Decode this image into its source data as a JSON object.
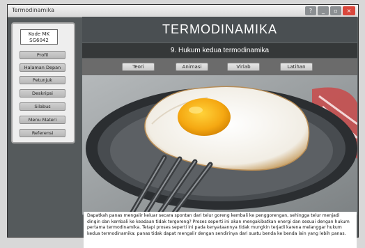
{
  "window": {
    "title": "Termodinamika"
  },
  "window_controls": [
    "?",
    "_",
    "▫",
    "×"
  ],
  "kode": {
    "line1": "Kode MK",
    "line2": "SG6042"
  },
  "sidebar": {
    "items": [
      {
        "label": "Profil"
      },
      {
        "label": "Halaman Depan"
      },
      {
        "label": "Petunjuk"
      },
      {
        "label": "Deskripsi"
      },
      {
        "label": "Silabus"
      },
      {
        "label": "Menu Materi"
      },
      {
        "label": "Referensi"
      }
    ]
  },
  "main": {
    "title": "TERMODINAMIKA",
    "section": "9. Hukum kedua termodinamika",
    "tabs": [
      {
        "label": "Teori"
      },
      {
        "label": "Animasi"
      },
      {
        "label": "Virlab"
      },
      {
        "label": "Latihan"
      }
    ],
    "caption": "Dapatkah panas mengalir keluar secara spontan dari telur goreng kembali ke penggorengan, sehingga telur menjadi dingin dan kembali ke keadaan tidak tergoreng? Proses seperti ini akan mengakibatkan energi dan sesuai dengan hukum pertama termodinamika. Tetapi proses seperti ini pada kenyataannya tidak mungkin terjadi karena melanggar hukum kedua termodinamika: panas tidak dapat mengalir dengan sendirinya dari suatu benda ke benda lain yang lebih panas."
  },
  "colors": {
    "window_bg": "#555a5c",
    "header_bg": "#4a4f52",
    "subheader_bg": "#353839",
    "tabbar_bg": "#6b6b6b",
    "close_btn": "#d9463b"
  }
}
